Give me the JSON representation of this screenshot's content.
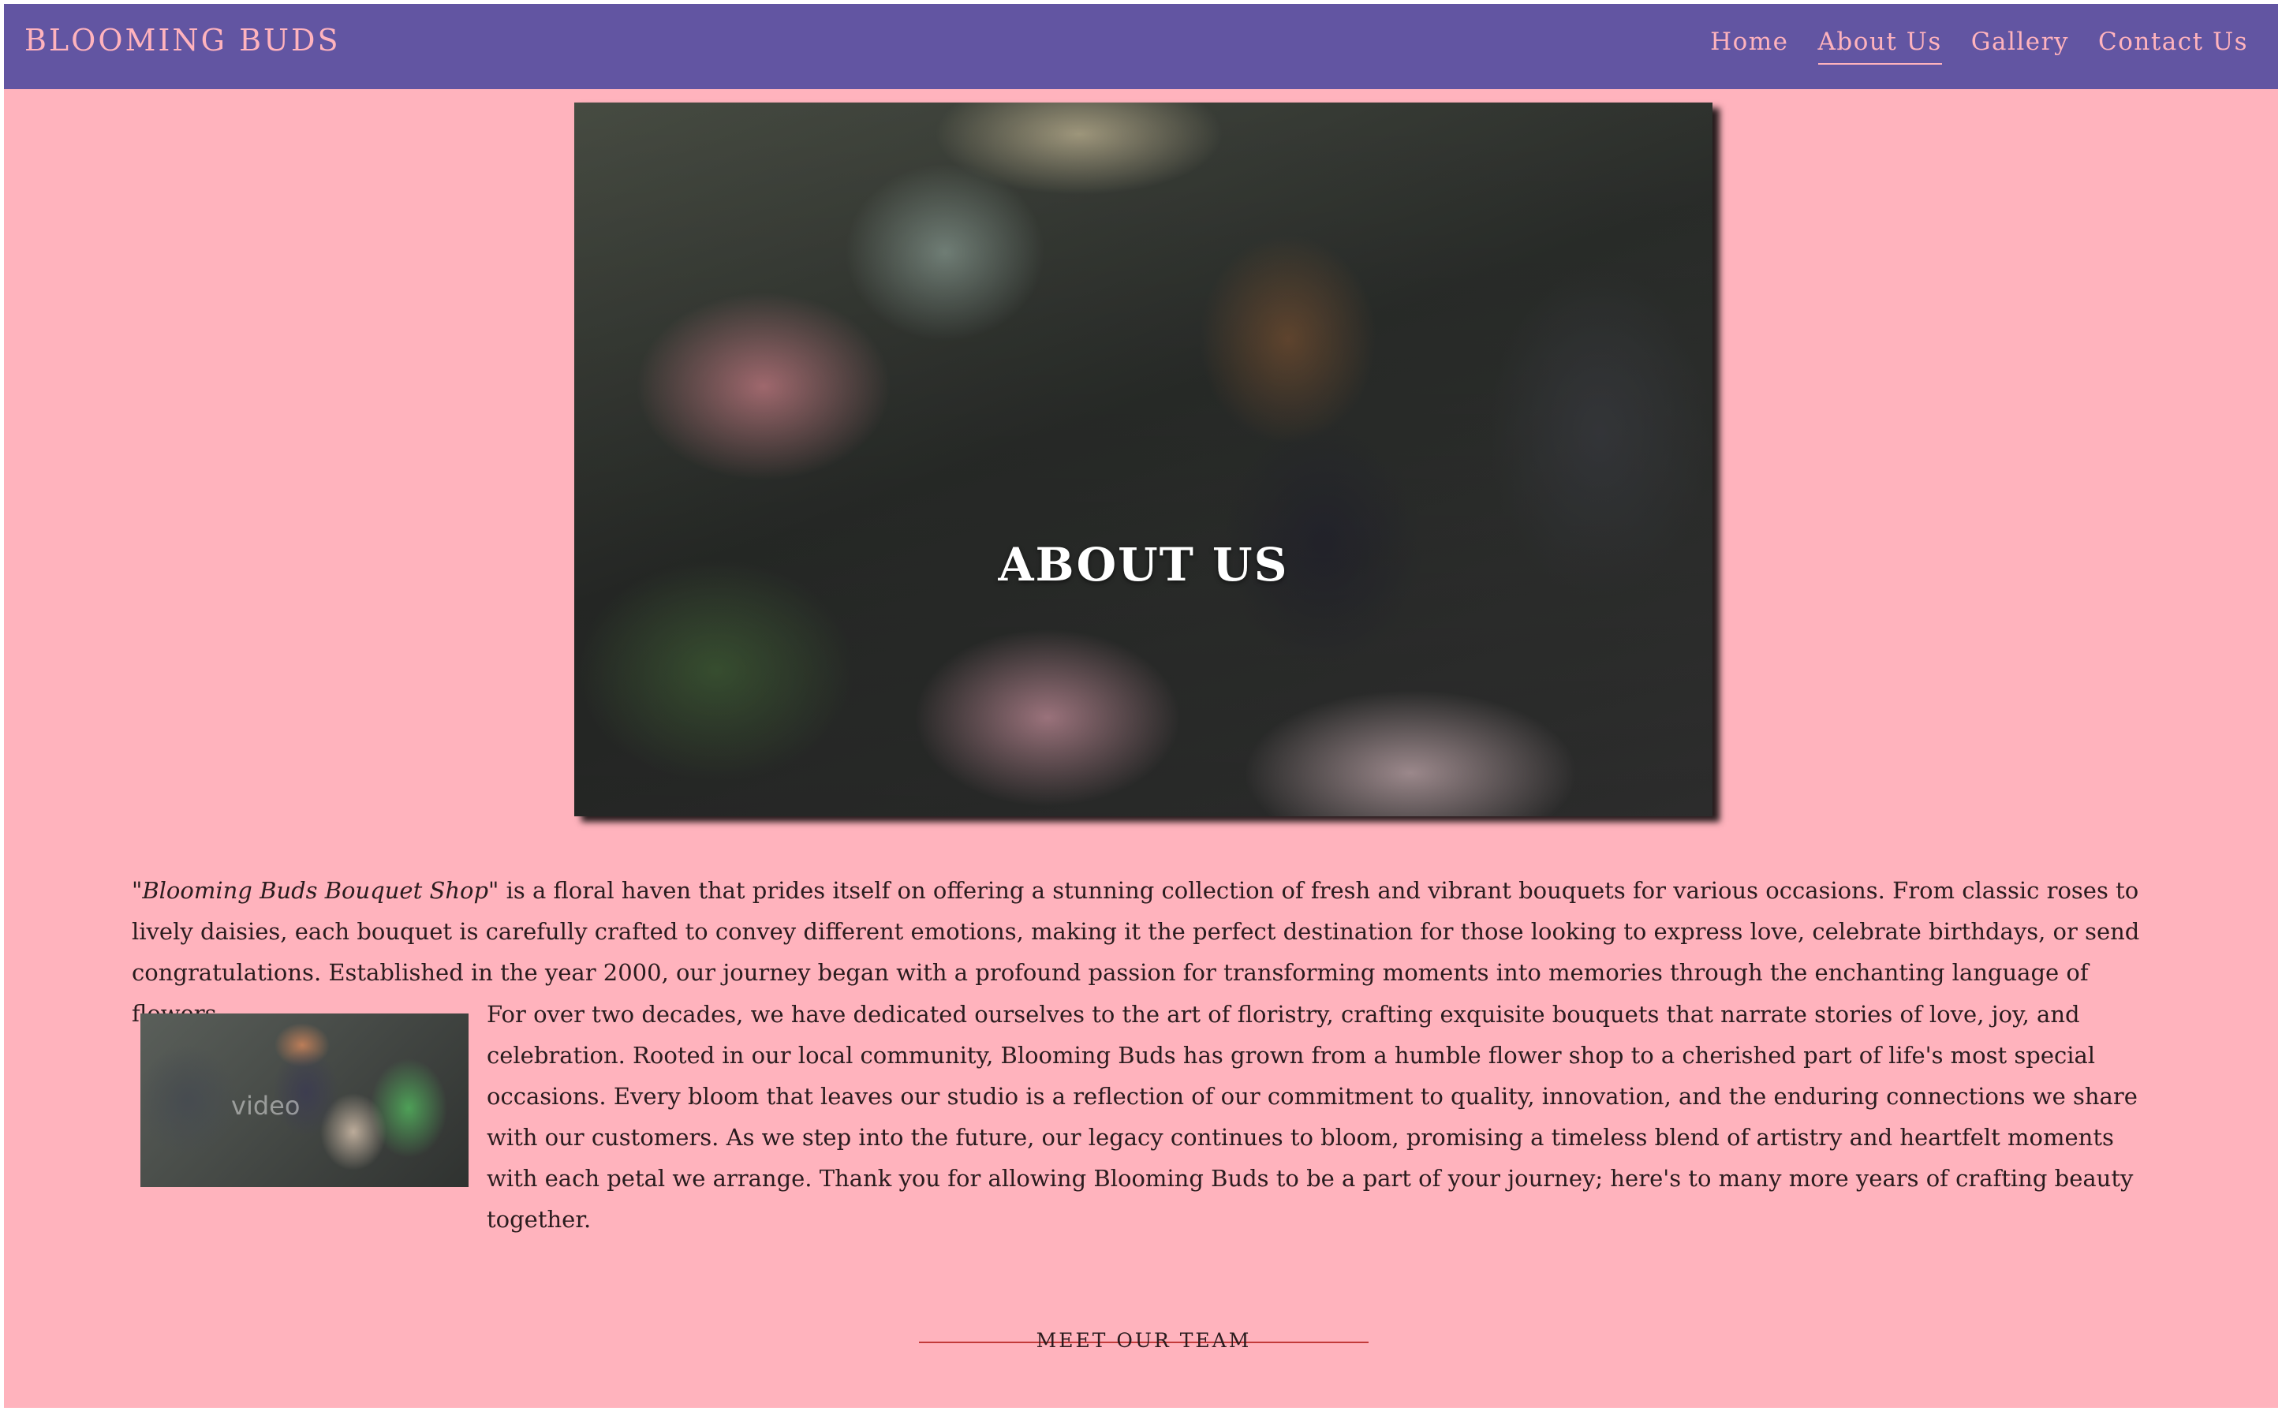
{
  "header": {
    "brand": "BLOOMING BUDS",
    "nav": [
      {
        "label": "Home"
      },
      {
        "label": "About Us",
        "active": true
      },
      {
        "label": "Gallery"
      },
      {
        "label": "Contact Us"
      }
    ]
  },
  "hero": {
    "title": "ABOUT US"
  },
  "intro": {
    "shop_name": "\"Blooming Buds Bouquet Shop\"",
    "text": " is a floral haven that prides itself on offering a stunning collection of fresh and vibrant bouquets for various occasions. From classic roses to lively daisies, each bouquet is carefully crafted to convey different emotions, making it the perfect destination for those looking to express love, celebrate birthdays, or send congratulations. Established in the year 2000, our journey began with a profound passion for transforming moments into memories through the enchanting language of flowers."
  },
  "media": {
    "watermark": "video"
  },
  "story": {
    "text": "For over two decades, we have dedicated ourselves to the art of floristry, crafting exquisite bouquets that narrate stories of love, joy, and celebration. Rooted in our local community, Blooming Buds has grown from a humble flower shop to a cherished part of life's most special occasions. Every bloom that leaves our studio is a reflection of our commitment to quality, innovation, and the enduring connections we share with our customers. As we step into the future, our legacy continues to bloom, promising a timeless blend of artistry and heartfelt moments with each petal we arrange. Thank you for allowing Blooming Buds to be a part of your journey; here's to many more years of crafting beauty together."
  },
  "team": {
    "label": "MEET OUR TEAM"
  },
  "colors": {
    "navbar": "#6255a2",
    "page_background": "#ffb3bd",
    "nav_text": "#ffb3bd",
    "divider": "#c23a3a"
  }
}
